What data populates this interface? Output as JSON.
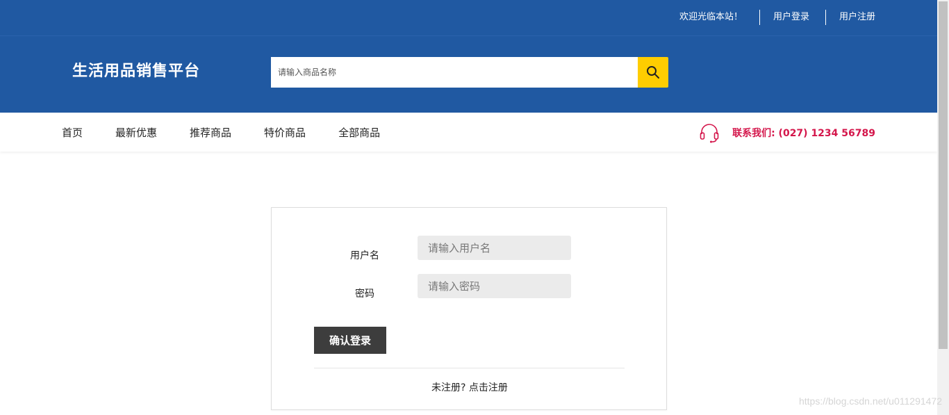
{
  "topbar": {
    "welcome": "欢迎光临本站！",
    "login": "用户登录",
    "register": "用户注册"
  },
  "header": {
    "logo": "生活用品销售平台",
    "search_placeholder": "请输入商品名称",
    "search_icon": "search-icon"
  },
  "nav": {
    "items": [
      {
        "label": "首页"
      },
      {
        "label": "最新优惠"
      },
      {
        "label": "推荐商品"
      },
      {
        "label": "特价商品"
      },
      {
        "label": "全部商品"
      }
    ],
    "contact_icon": "headset-icon",
    "contact": "联系我们: (027) 1234 56789"
  },
  "login_form": {
    "username_label": "用户名",
    "username_placeholder": "请输入用户名",
    "password_label": "密码",
    "password_placeholder": "请输入密码",
    "submit": "确认登录",
    "register_link": "未注册? 点击注册"
  },
  "watermark": "https://blog.csdn.net/u011291472",
  "colors": {
    "brand_blue": "#2059a2",
    "search_button": "#ffcd00",
    "contact_red": "#d4164b",
    "button_dark": "#3d3d3d"
  }
}
